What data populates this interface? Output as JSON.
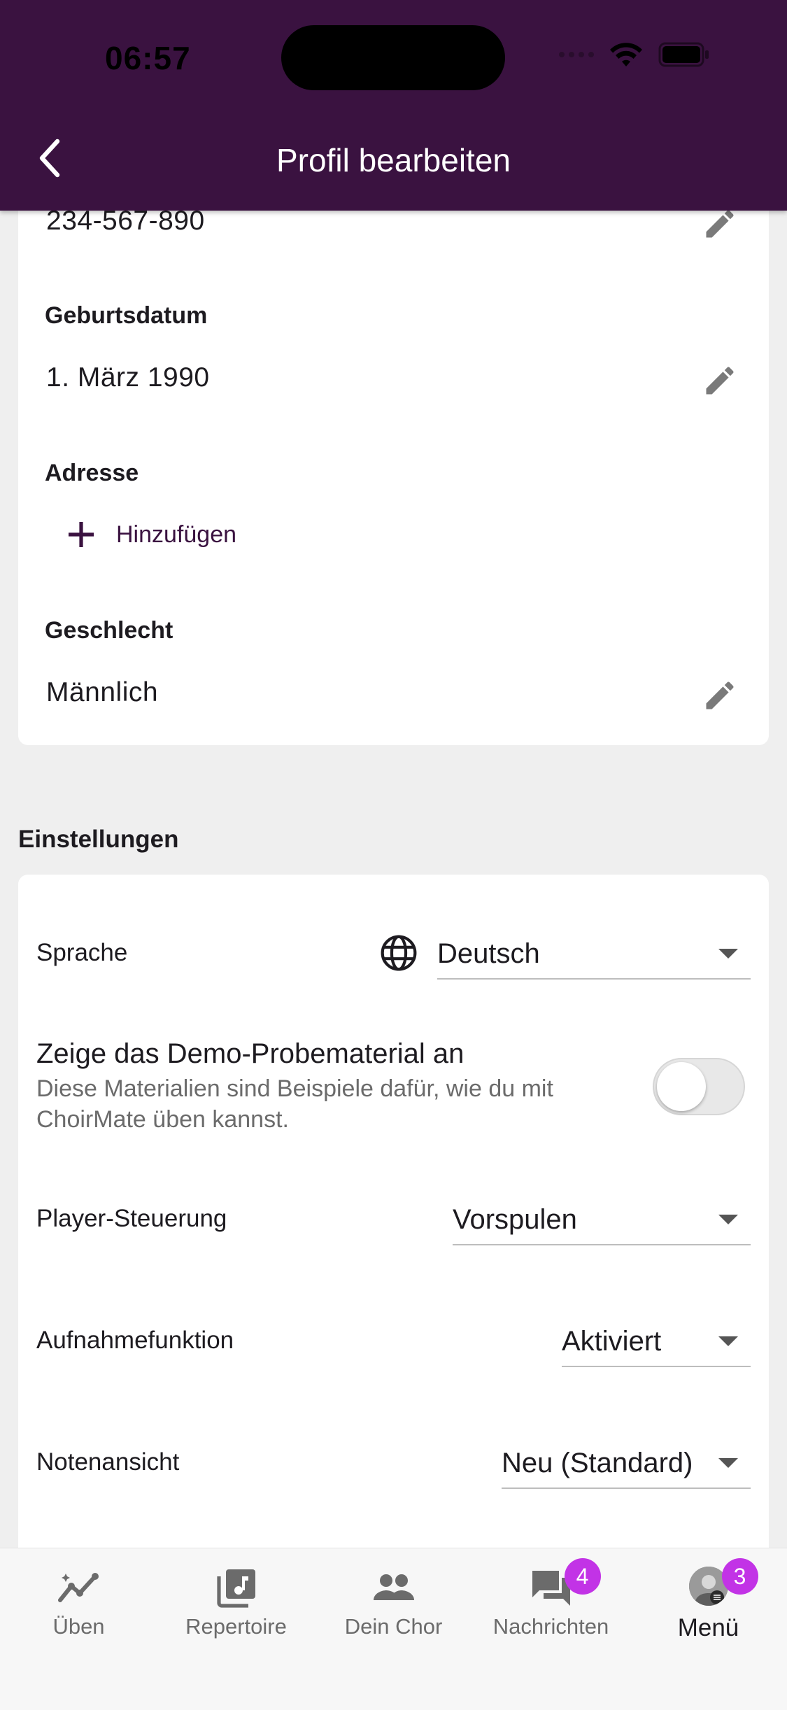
{
  "status_bar": {
    "time": "06:57"
  },
  "header": {
    "title": "Profil bearbeiten"
  },
  "profile": {
    "phone_value": "234-567-890",
    "birthdate_label": "Geburtsdatum",
    "birthdate_value": "1. März 1990",
    "address_label": "Adresse",
    "add_label": "Hinzufügen",
    "gender_label": "Geschlecht",
    "gender_value": "Männlich"
  },
  "settings": {
    "section_title": "Einstellungen",
    "language_label": "Sprache",
    "language_value": "Deutsch",
    "demo_title": "Zeige das Demo-Probematerial an",
    "demo_subtitle": "Diese Materialien sind Beispiele dafür, wie du mit ChoirMate üben kannst.",
    "demo_enabled": false,
    "player_label": "Player-Steuerung",
    "player_value": "Vorspulen",
    "recording_label": "Aufnahmefunktion",
    "recording_value": "Aktiviert",
    "notes_label": "Notenansicht",
    "notes_value": "Neu (Standard)"
  },
  "bottom_nav": {
    "items": [
      {
        "label": "Üben",
        "icon": "practice-trend-icon"
      },
      {
        "label": "Repertoire",
        "icon": "music-library-icon"
      },
      {
        "label": "Dein Chor",
        "icon": "people-icon"
      },
      {
        "label": "Nachrichten",
        "icon": "chat-icon",
        "badge": "4"
      },
      {
        "label": "Menü",
        "icon": "avatar",
        "badge": "3"
      }
    ]
  },
  "colors": {
    "header": "#3a1240",
    "badge": "#c233e6",
    "accent": "#3a1240"
  }
}
